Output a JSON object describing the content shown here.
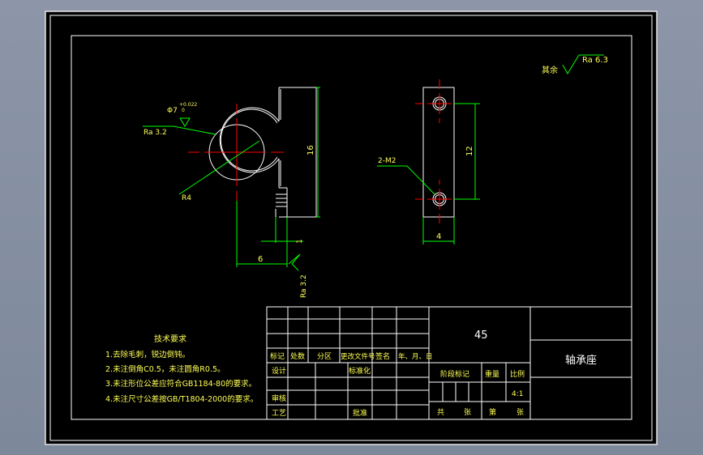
{
  "colors": {
    "background": "#000000",
    "frame": "#ffffff",
    "part": "#ffffff",
    "dimension": "#00ff00",
    "centerline": "#ff0000",
    "text": "#ffff55"
  },
  "roughness_general": {
    "label": "其余",
    "value": "Ra 6.3"
  },
  "front_view": {
    "dim_height": "16",
    "dim_width": "6",
    "dim_step": "1",
    "hole_label": "Φ7",
    "hole_tol_upper": "+0.022",
    "hole_tol_lower": "0",
    "radius_label": "R4",
    "roughness_hole": "Ra 3.2",
    "roughness_base": "Ra 3.2"
  },
  "side_view": {
    "dim_height": "12",
    "dim_width": "4",
    "hole_label": "2-M2"
  },
  "technical_requirements": {
    "title": "技术要求",
    "items": [
      "1.去除毛刺，锐边倒钝。",
      "2.未注倒角C0.5，未注圆角R0.5。",
      "3.未注形位公差应符合GB1184-80的要求。",
      "4.未注尺寸公差按GB/T1804-2000的要求。"
    ]
  },
  "title_block": {
    "material": "45",
    "part_name": "轴承座",
    "headers": [
      "标记",
      "处数",
      "分区",
      "更改文件号",
      "签名",
      "年、月、日"
    ],
    "design": "设计",
    "standardize": "标准化",
    "review": "审核",
    "process": "工艺",
    "approve": "批准",
    "stage_mark": "阶段标记",
    "weight": "重量",
    "scale": "比例",
    "scale_value": "4:1",
    "sheets_total": "共",
    "sheets_unit": "张",
    "sheet_no": "第",
    "sheet_unit": "张"
  }
}
